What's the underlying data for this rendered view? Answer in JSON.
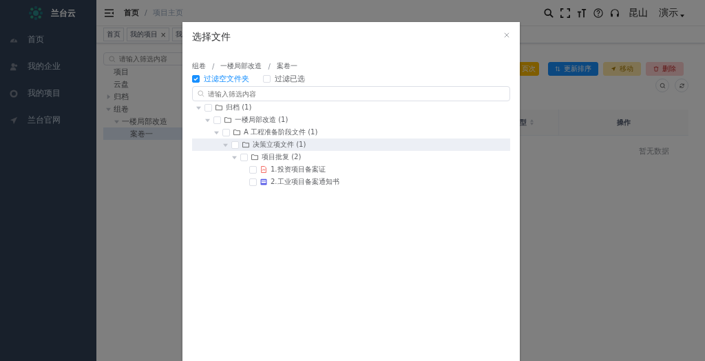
{
  "sidebar": {
    "logo_text": "兰台云",
    "items": [
      {
        "label": "首页"
      },
      {
        "label": "我的企业"
      },
      {
        "label": "我的项目"
      },
      {
        "label": "兰台官网"
      }
    ]
  },
  "header": {
    "breadcrumb": [
      "首页",
      "项目主页"
    ],
    "separator": "/",
    "city": "昆山",
    "user": "演示"
  },
  "tags": [
    {
      "label": "首页"
    },
    {
      "label": "我的项目",
      "close": "×"
    },
    {
      "label": "我"
    }
  ],
  "project_tree": {
    "placeholder": "请输入筛选内容",
    "nodes": [
      {
        "label": "项目",
        "kind": "leaf",
        "selected": false
      },
      {
        "label": "云盘",
        "kind": "leaf",
        "selected": false
      },
      {
        "label": "归档",
        "kind": "branch",
        "expanded": false,
        "selected": false
      },
      {
        "label": "组卷",
        "kind": "branch",
        "expanded": true,
        "selected": false,
        "children": [
          {
            "label": "一楼局部改造",
            "kind": "branch",
            "expanded": true,
            "selected": false,
            "children": [
              {
                "label": "案卷一",
                "kind": "leaf",
                "selected": true
              }
            ]
          }
        ]
      }
    ]
  },
  "toolbar": [
    {
      "label": "页次",
      "kind": "warning",
      "disabled": false
    },
    {
      "label": "更新排序",
      "kind": "primary",
      "disabled": false
    },
    {
      "label": "移动",
      "kind": "warning",
      "disabled": true
    },
    {
      "label": "删除",
      "kind": "danger",
      "disabled": true
    }
  ],
  "table": {
    "columns": [
      "型",
      "操作"
    ],
    "empty_text": "暂无数据"
  },
  "dialog": {
    "title": "选择文件",
    "path": [
      "组卷",
      "一楼局部改造",
      "案卷一"
    ],
    "separator": "/",
    "filters": [
      {
        "label": "过滤空文件夹",
        "checked": true
      },
      {
        "label": "过滤已选",
        "checked": false
      }
    ],
    "search": {
      "placeholder": "请输入筛选内容"
    },
    "tree": [
      {
        "label": "归档 (1)",
        "kind": "folder",
        "checked": false,
        "expanded": true,
        "highlighted": false,
        "children": [
          {
            "label": "一楼局部改造 (1)",
            "kind": "folder",
            "checked": false,
            "expanded": true,
            "highlighted": false,
            "children": [
              {
                "label": "A 工程准备阶段文件 (1)",
                "kind": "folder",
                "checked": false,
                "expanded": true,
                "highlighted": false,
                "children": [
                  {
                    "label": "决策立项文件 (1)",
                    "kind": "folder",
                    "checked": false,
                    "expanded": true,
                    "highlighted": true,
                    "children": [
                      {
                        "label": "项目批复 (2)",
                        "kind": "folder",
                        "checked": false,
                        "expanded": true,
                        "highlighted": false,
                        "children": [
                          {
                            "label": "1.投资项目备案证",
                            "kind": "pdf",
                            "checked": false,
                            "highlighted": false
                          },
                          {
                            "label": "2.工业项目备案通知书",
                            "kind": "doc",
                            "checked": false,
                            "highlighted": false
                          }
                        ]
                      }
                    ]
                  }
                ]
              }
            ]
          }
        ]
      }
    ]
  }
}
